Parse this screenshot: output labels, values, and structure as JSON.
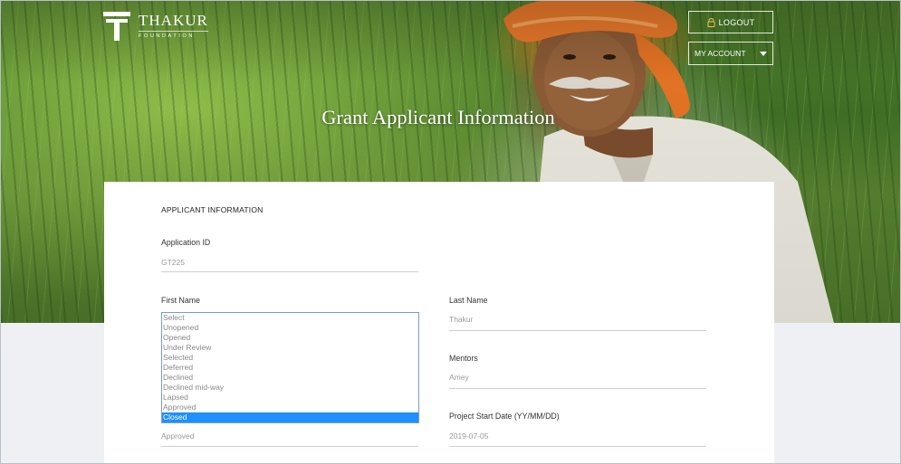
{
  "header": {
    "logo_name": "THAKUR",
    "logo_sub": "FOUNDATION",
    "logout_label": "LOGOUT",
    "account_label": "MY ACCOUNT",
    "page_title": "Grant Applicant Information"
  },
  "form": {
    "section_title": "APPLICANT INFORMATION",
    "application_id": {
      "label": "Application ID",
      "value": "GT225"
    },
    "first_name": {
      "label": "First Name",
      "options": [
        "Select",
        "Unopened",
        "Opened",
        "Under Review",
        "Selected",
        "Deferred",
        "Declined",
        "Declined mid-way",
        "Lapsed",
        "Approved",
        "Closed"
      ],
      "highlighted": "Closed",
      "value": "Approved"
    },
    "last_name": {
      "label": "Last Name",
      "value": "Thakur"
    },
    "mentors": {
      "label": "Mentors",
      "value": "Amey"
    },
    "project_start": {
      "label": "Project Start Date (YY/MM/DD)",
      "value": "2019-07-05"
    }
  },
  "colors": {
    "highlight": "#1e90ff",
    "listbox_border": "#7a9ccf",
    "turban": "#e8782a"
  },
  "icons": [
    "logo-mark-icon",
    "lock-icon",
    "caret-down-icon"
  ]
}
